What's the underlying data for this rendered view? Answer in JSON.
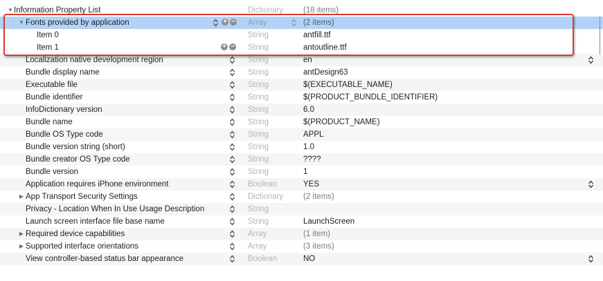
{
  "root": {
    "key": "Information Property List",
    "type": "Dictionary",
    "value": "(18 items)"
  },
  "rows": [
    {
      "key": "Fonts provided by application",
      "type": "Array",
      "value": "(2 items)",
      "level": 1,
      "disclosure": "open",
      "selected": true,
      "addremove": true,
      "type_stepper": true,
      "key_stepper": true
    },
    {
      "key": "Item 0",
      "type": "String",
      "value": "antfill.ttf",
      "level": 2,
      "selected": false
    },
    {
      "key": "Item 1",
      "type": "String",
      "value": "antoutline.ttf",
      "level": 2,
      "addremove": true
    },
    {
      "key": "Localization native development region",
      "type": "String",
      "value": "en",
      "level": 1,
      "key_stepper": true,
      "value_stepper": true
    },
    {
      "key": "Bundle display name",
      "type": "String",
      "value": "antDesign63",
      "level": 1,
      "key_stepper": true
    },
    {
      "key": "Executable file",
      "type": "String",
      "value": "$(EXECUTABLE_NAME)",
      "level": 1,
      "key_stepper": true
    },
    {
      "key": "Bundle identifier",
      "type": "String",
      "value": "$(PRODUCT_BUNDLE_IDENTIFIER)",
      "level": 1,
      "key_stepper": true
    },
    {
      "key": "InfoDictionary version",
      "type": "String",
      "value": "6.0",
      "level": 1,
      "key_stepper": true
    },
    {
      "key": "Bundle name",
      "type": "String",
      "value": "$(PRODUCT_NAME)",
      "level": 1,
      "key_stepper": true
    },
    {
      "key": "Bundle OS Type code",
      "type": "String",
      "value": "APPL",
      "level": 1,
      "key_stepper": true
    },
    {
      "key": "Bundle version string (short)",
      "type": "String",
      "value": "1.0",
      "level": 1,
      "key_stepper": true
    },
    {
      "key": "Bundle creator OS Type code",
      "type": "String",
      "value": "????",
      "level": 1,
      "key_stepper": true
    },
    {
      "key": "Bundle version",
      "type": "String",
      "value": "1",
      "level": 1,
      "key_stepper": true
    },
    {
      "key": "Application requires iPhone environment",
      "type": "Boolean",
      "value": "YES",
      "level": 1,
      "key_stepper": true,
      "value_stepper": true
    },
    {
      "key": "App Transport Security Settings",
      "type": "Dictionary",
      "value": "(2 items)",
      "level": 1,
      "disclosure": "closed",
      "key_stepper": true
    },
    {
      "key": "Privacy - Location When In Use Usage Description",
      "type": "String",
      "value": "",
      "level": 1,
      "key_stepper": true
    },
    {
      "key": "Launch screen interface file base name",
      "type": "String",
      "value": "LaunchScreen",
      "level": 1,
      "key_stepper": true
    },
    {
      "key": "Required device capabilities",
      "type": "Array",
      "value": "(1 item)",
      "level": 1,
      "disclosure": "closed",
      "key_stepper": true
    },
    {
      "key": "Supported interface orientations",
      "type": "Array",
      "value": "(3 items)",
      "level": 1,
      "disclosure": "closed",
      "key_stepper": true
    },
    {
      "key": "View controller-based status bar appearance",
      "type": "Boolean",
      "value": "NO",
      "level": 1,
      "key_stepper": true,
      "value_stepper": true
    }
  ],
  "colors": {
    "selected_row": "#b3d2f7",
    "highlight_border": "#d93a2f",
    "type_text": "#b4b4b4"
  }
}
